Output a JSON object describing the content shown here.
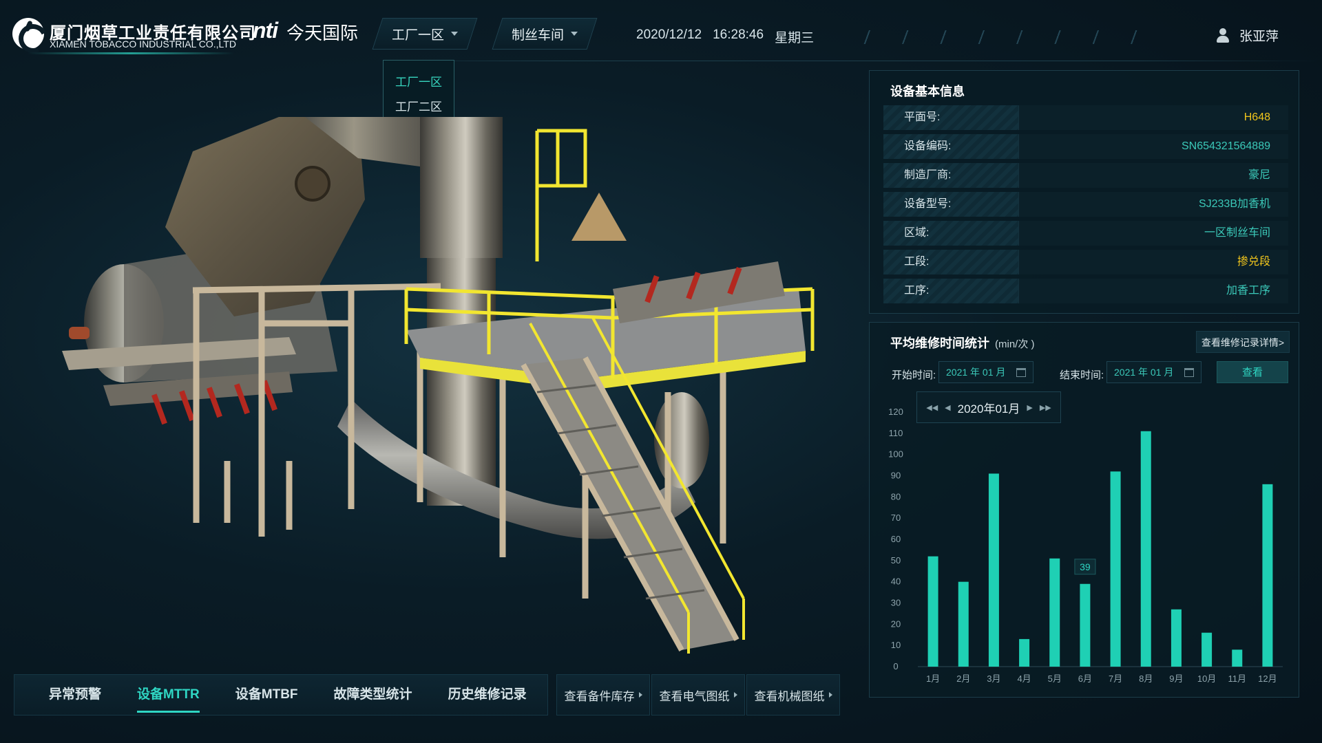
{
  "header": {
    "company_cn": "厦门烟草工业责任有限公司",
    "company_en": "XIAMEN TOBACCO INDUSTRIAL CO.,LTD",
    "partner_logo": "nti",
    "partner_name": "今天国际",
    "factory_dropdown": "工厂一区",
    "workshop_dropdown": "制丝车间",
    "date": "2020/12/12",
    "time": "16:28:46",
    "weekday": "星期三",
    "user_name": "张亚萍",
    "user_icon": "user-icon"
  },
  "factory_menu": {
    "options": [
      "工厂一区",
      "工厂二区"
    ],
    "selected": "工厂一区"
  },
  "bottom_tabs": {
    "tabs": [
      "异常预警",
      "设备MTTR",
      "设备MTBF",
      "故障类型统计",
      "历史维修记录"
    ],
    "active": "设备MTTR",
    "links": [
      "查看备件库存",
      "查看电气图纸",
      "查看机械图纸"
    ]
  },
  "device_info": {
    "title": "设备基本信息",
    "rows": [
      {
        "label": "平面号:",
        "value": "H648"
      },
      {
        "label": "设备编码:",
        "value": "SN654321564889"
      },
      {
        "label": "制造厂商:",
        "value": "豪尼"
      },
      {
        "label": "设备型号:",
        "value": "SJ233B加香机"
      },
      {
        "label": "区域:",
        "value": "一区制丝车间"
      },
      {
        "label": "工段:",
        "value": "掺兑段"
      },
      {
        "label": "工序:",
        "value": "加香工序"
      }
    ]
  },
  "mttr": {
    "title": "平均维修时间统计",
    "unit": "(min/次 )",
    "detail_button": "查看维修记录详情>",
    "start_label": "开始时间:",
    "start_value": "2021 年 01 月",
    "end_label": "结束时间:",
    "end_value": "2021 年 01 月",
    "query_button": "查看",
    "month_picker": "2020年01月"
  },
  "chart_data": {
    "type": "bar",
    "categories": [
      "1月",
      "2月",
      "3月",
      "4月",
      "5月",
      "6月",
      "7月",
      "8月",
      "9月",
      "10月",
      "11月",
      "12月"
    ],
    "values": [
      52,
      40,
      91,
      13,
      51,
      39,
      92,
      111,
      27,
      16,
      8,
      86
    ],
    "ylim": [
      0,
      120
    ],
    "yticks": [
      0,
      10,
      20,
      30,
      40,
      50,
      60,
      70,
      80,
      90,
      100,
      110,
      120
    ],
    "tooltip": {
      "category": "6月",
      "value": 39
    },
    "bar_color": "#1fd0b4",
    "grid": false
  },
  "colors": {
    "accent": "#2fd6c3",
    "highlight": "#f2c61c",
    "background": "#06121a"
  }
}
